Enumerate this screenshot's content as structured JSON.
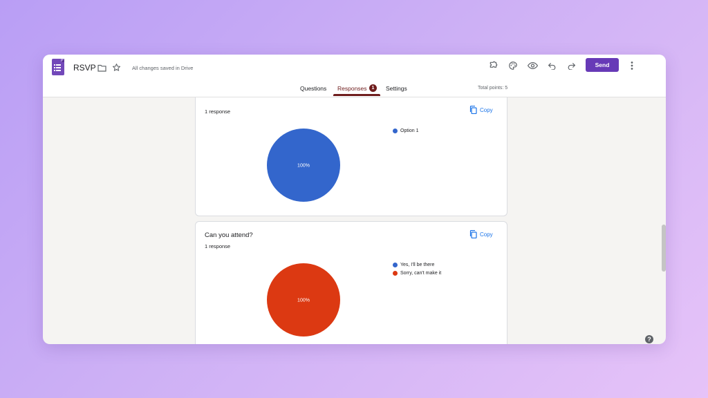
{
  "header": {
    "title": "RSVP",
    "saved_status": "All changes saved in Drive",
    "send_label": "Send",
    "icons": [
      "forms-logo-icon",
      "folder-icon",
      "star-icon",
      "addon-puzzle-icon",
      "palette-icon",
      "preview-eye-icon",
      "undo-icon",
      "redo-icon",
      "more-vert-icon"
    ]
  },
  "tabs": [
    {
      "label": "Questions"
    },
    {
      "label": "Responses",
      "badge": "1",
      "active": true
    },
    {
      "label": "Settings"
    }
  ],
  "total_points": "Total points: 5",
  "cards": [
    {
      "title": "",
      "response_count": "1 response",
      "copy_label": "Copy",
      "chart_data": {
        "type": "pie",
        "slices": [
          {
            "label": "Option 1",
            "value": 100,
            "color": "#3366cc"
          }
        ],
        "data_label": "100%"
      }
    },
    {
      "title": "Can you attend?",
      "response_count": "1 response",
      "copy_label": "Copy",
      "chart_data": {
        "type": "pie",
        "slices": [
          {
            "label": "Yes, I'll be there",
            "value": 0,
            "color": "#3366cc"
          },
          {
            "label": "Sorry, can't make it",
            "value": 100,
            "color": "#dc3912"
          }
        ],
        "data_label": "100%"
      }
    }
  ],
  "colors": {
    "accent": "#673ab7",
    "tab_active": "#6f1d1d",
    "link": "#1a73e8"
  }
}
